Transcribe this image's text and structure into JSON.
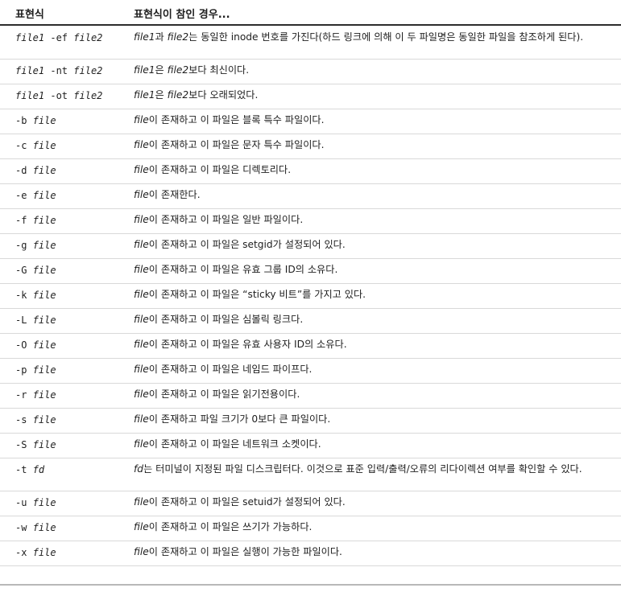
{
  "table": {
    "header": {
      "col1": "표현식",
      "col2": "표현식이 참인 경우..."
    },
    "rows": [
      {
        "opt": "",
        "a1": "file1",
        "op": "-ef",
        "a2": "file2",
        "parts": [
          {
            "i": "file1"
          },
          {
            "t": "과 "
          },
          {
            "i": "file2"
          },
          {
            "t": "는 동일한 inode 번호를 가진다(하드 링크에 의해 이 두 파일명은 동일한 파일을 참조하게 된다)."
          }
        ]
      },
      {
        "opt": "",
        "a1": "file1",
        "op": "-nt",
        "a2": "file2",
        "parts": [
          {
            "i": "file1"
          },
          {
            "t": "은 "
          },
          {
            "i": "file2"
          },
          {
            "t": "보다 최신이다."
          }
        ]
      },
      {
        "opt": "",
        "a1": "file1",
        "op": "-ot",
        "a2": "file2",
        "parts": [
          {
            "i": "file1"
          },
          {
            "t": "은 "
          },
          {
            "i": "file2"
          },
          {
            "t": "보다 오래되었다."
          }
        ]
      },
      {
        "opt": "-b",
        "a1": "file",
        "parts": [
          {
            "i": "file"
          },
          {
            "t": "이 존재하고 이 파일은 블록 특수 파일이다."
          }
        ]
      },
      {
        "opt": "-c",
        "a1": "file",
        "parts": [
          {
            "i": "file"
          },
          {
            "t": "이 존재하고 이 파일은 문자 특수 파일이다."
          }
        ]
      },
      {
        "opt": "-d",
        "a1": "file",
        "parts": [
          {
            "i": "file"
          },
          {
            "t": "이 존재하고 이 파일은 디렉토리다."
          }
        ]
      },
      {
        "opt": "-e",
        "a1": "file",
        "parts": [
          {
            "i": "file"
          },
          {
            "t": "이 존재한다."
          }
        ]
      },
      {
        "opt": "-f",
        "a1": "file",
        "parts": [
          {
            "i": "file"
          },
          {
            "t": "이 존재하고 이 파일은 일반 파일이다."
          }
        ]
      },
      {
        "opt": "-g",
        "a1": "file",
        "parts": [
          {
            "i": "file"
          },
          {
            "t": "이 존재하고 이 파일은 setgid가 설정되어 있다."
          }
        ]
      },
      {
        "opt": "-G",
        "a1": "file",
        "parts": [
          {
            "i": "file"
          },
          {
            "t": "이 존재하고 이 파일은 유효 그룹 ID의 소유다."
          }
        ]
      },
      {
        "opt": "-k",
        "a1": "file",
        "parts": [
          {
            "i": "file"
          },
          {
            "t": "이 존재하고 이 파일은 “sticky 비트”를 가지고 있다."
          }
        ]
      },
      {
        "opt": "-L",
        "a1": "file",
        "parts": [
          {
            "i": "file"
          },
          {
            "t": "이 존재하고 이 파일은 심볼릭 링크다."
          }
        ]
      },
      {
        "opt": "-O",
        "a1": "file",
        "parts": [
          {
            "i": "file"
          },
          {
            "t": "이 존재하고 이 파일은 유효 사용자 ID의 소유다."
          }
        ]
      },
      {
        "opt": "-p",
        "a1": "file",
        "parts": [
          {
            "i": "file"
          },
          {
            "t": "이 존재하고 이 파일은 네임드 파이프다."
          }
        ]
      },
      {
        "opt": "-r",
        "a1": "file",
        "parts": [
          {
            "i": "file"
          },
          {
            "t": "이 존재하고 이 파일은 읽기전용이다."
          }
        ]
      },
      {
        "opt": "-s",
        "a1": "file",
        "parts": [
          {
            "i": "file"
          },
          {
            "t": "이 존재하고 파일 크기가 0보다 큰 파일이다."
          }
        ]
      },
      {
        "opt": "-S",
        "a1": "file",
        "parts": [
          {
            "i": "file"
          },
          {
            "t": "이 존재하고 이 파일은 네트워크 소켓이다."
          }
        ]
      },
      {
        "opt": "-t",
        "a1": "fd",
        "parts": [
          {
            "i": "fd"
          },
          {
            "t": "는 터미널이 지정된 파일 디스크립터다. 이것으로 표준 입력/출력/오류의 리다이렉션 여부를 확인할 수 있다."
          }
        ]
      },
      {
        "opt": "-u",
        "a1": "file",
        "parts": [
          {
            "i": "file"
          },
          {
            "t": "이 존재하고 이 파일은 setuid가 설정되어 있다."
          }
        ]
      },
      {
        "opt": "-w",
        "a1": "file",
        "parts": [
          {
            "i": "file"
          },
          {
            "t": "이 존재하고 이 파일은 쓰기가 가능하다."
          }
        ]
      },
      {
        "opt": "-x",
        "a1": "file",
        "parts": [
          {
            "i": "file"
          },
          {
            "t": "이 존재하고 이 파일은 실행이 가능한 파일이다."
          }
        ]
      }
    ]
  }
}
